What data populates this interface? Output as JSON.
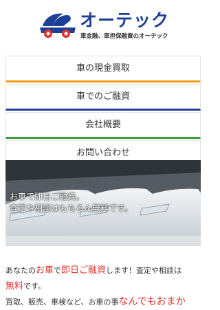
{
  "header": {
    "logo_text": "オーテック",
    "tagline": "車金融、車担保融資のオーテック",
    "colors": {
      "blue": "#1d3f96",
      "red": "#e0332c"
    }
  },
  "nav": [
    {
      "label": "車の現金買取",
      "accent": "#f39c12"
    },
    {
      "label": "車でのご融資",
      "accent": "#1d3f96"
    },
    {
      "label": "会社概要",
      "accent": "#3a9a3a"
    },
    {
      "label": "お問い合わせ",
      "accent": "#e0332c"
    }
  ],
  "hero": {
    "line1": "お車で即日ご融資。",
    "line2": "査定や相談はもちろん無料です。"
  },
  "intro": {
    "p1_a": "あなたの",
    "p1_b": "お車",
    "p1_c": "で",
    "p1_d": "即日ご融資",
    "p1_e": "します！査定や相談は",
    "p2_a": "無料",
    "p2_b": "です。",
    "p3_a": "買取、販売、車検など、お車の事",
    "p3_b": "なんでもおまか"
  }
}
